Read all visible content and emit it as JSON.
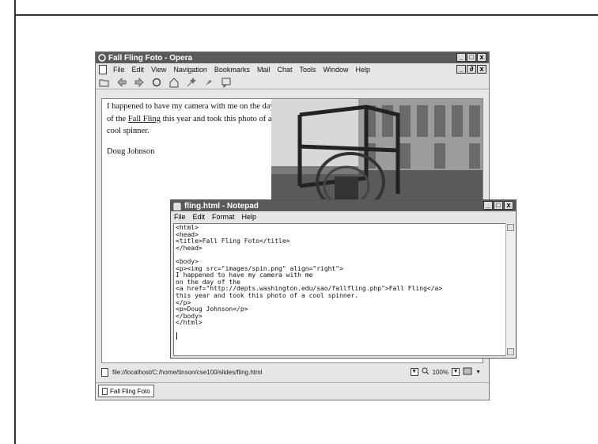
{
  "colors": {
    "titlebar": "#5a5a5a",
    "window_bg": "#e6e6e6"
  },
  "opera": {
    "title": "Fall Fling Foto - Opera",
    "menu": [
      "File",
      "Edit",
      "View",
      "Navigation",
      "Bookmarks",
      "Mail",
      "Chat",
      "Tools",
      "Window",
      "Help"
    ],
    "window_buttons": [
      "_",
      "□",
      "x"
    ],
    "inner_buttons": [
      "_",
      "∂",
      "x"
    ],
    "toolbar_icons": [
      "open-folder-icon",
      "back-icon",
      "forward-icon",
      "reload-icon",
      "home-icon",
      "wand-icon",
      "tools-icon",
      "chat-icon"
    ],
    "page": {
      "para_before": "I happened to have my camera with me on the day of the ",
      "link": "Fall Fling",
      "para_after": " this year and took this photo of a cool spinner.",
      "signature": "Doug Johnson"
    },
    "status": {
      "url": "file://localhost/C:/home/tinson/cse100/slides/fling.html",
      "zoom": "100%"
    },
    "tab": "Fall Fling Foto"
  },
  "notepad": {
    "title": "fling.html - Notepad",
    "menu": [
      "File",
      "Edit",
      "Format",
      "Help"
    ],
    "window_buttons": [
      "_",
      "□",
      "x"
    ],
    "code": "<html>\n<head>\n<title>Fall Fling Foto</title>\n</head>\n\n<body>\n<p><img src=\"images/spin.png\" align=\"right\">\nI happened to have my camera with me\non the day of the\n<a href=\"http://depts.washington.edu/sao/fallfling.php\">Fall Fling</a>\nthis year and took this photo of a cool spinner.\n</p>\n<p>Doug Johnson</p>\n</body>\n</html>"
  }
}
